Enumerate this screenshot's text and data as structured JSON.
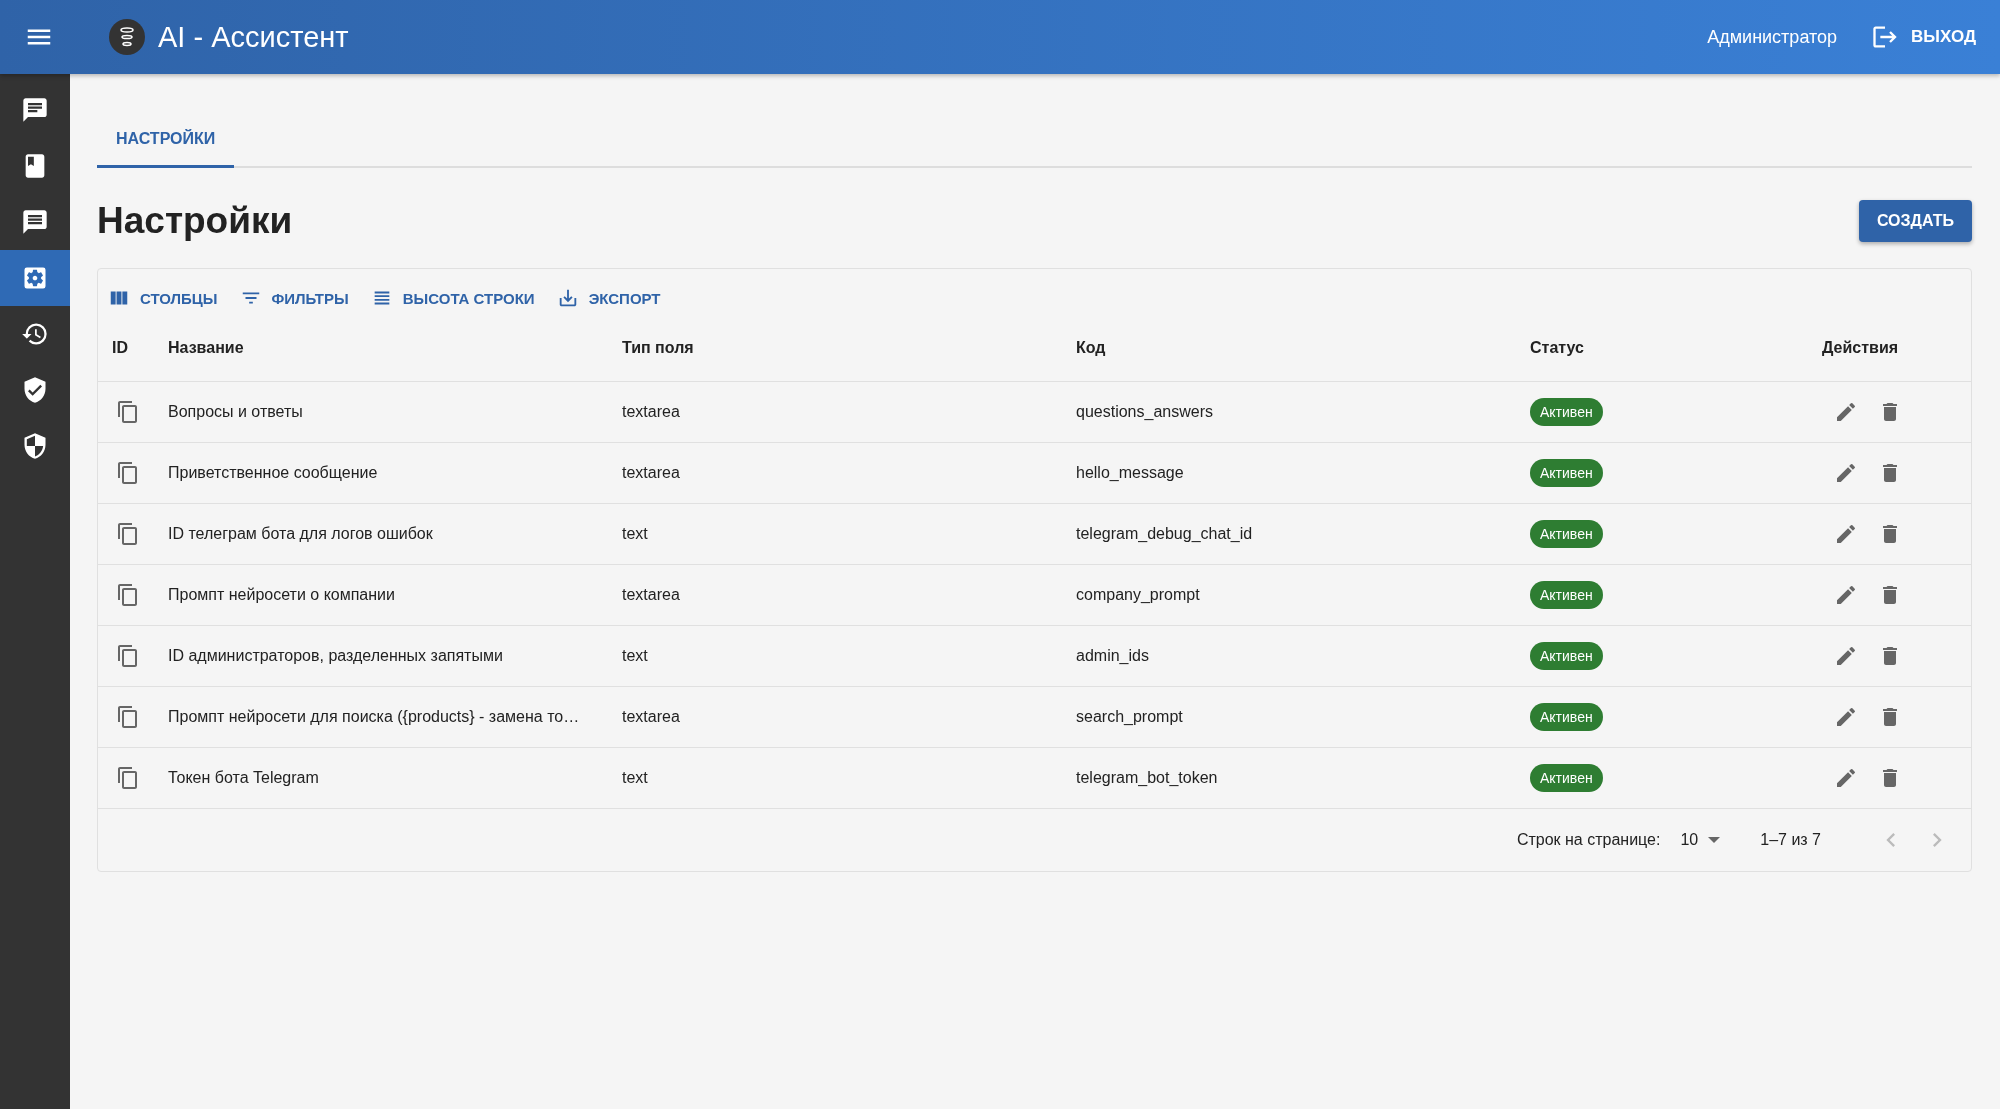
{
  "app_bar": {
    "title": "AI - Ассистент",
    "user": "Администратор",
    "logout": "ВЫХОД"
  },
  "sidebar": {
    "items": [
      {
        "selected": false
      },
      {
        "selected": false
      },
      {
        "selected": false
      },
      {
        "selected": true
      },
      {
        "selected": false
      },
      {
        "selected": false
      },
      {
        "selected": false
      }
    ]
  },
  "tabs": [
    {
      "label": "НАСТРОЙКИ",
      "selected": true
    }
  ],
  "page_title": "Настройки",
  "create_button": "СОЗДАТЬ",
  "toolbar": [
    "СТОЛБЦЫ",
    "ФИЛЬТРЫ",
    "ВЫСОТА СТРОКИ",
    "ЭКСПОРТ"
  ],
  "table": {
    "columns": [
      "ID",
      "Название",
      "Тип поля",
      "Код",
      "Статус",
      "Действия"
    ],
    "rows": [
      {
        "name": "Вопросы и ответы",
        "type": "textarea",
        "code": "questions_answers",
        "status": "Активен"
      },
      {
        "name": "Приветственное сообщение",
        "type": "textarea",
        "code": "hello_message",
        "status": "Активен"
      },
      {
        "name": "ID телеграм бота для логов ошибок",
        "type": "text",
        "code": "telegram_debug_chat_id",
        "status": "Активен"
      },
      {
        "name": "Промпт нейросети о компании",
        "type": "textarea",
        "code": "company_prompt",
        "status": "Активен"
      },
      {
        "name": "ID администраторов, разделенных запятыми",
        "type": "text",
        "code": "admin_ids",
        "status": "Активен"
      },
      {
        "name": "Промпт нейросети для поиска ({products} - замена то…",
        "type": "textarea",
        "code": "search_prompt",
        "status": "Активен"
      },
      {
        "name": "Токен бота Telegram",
        "type": "text",
        "code": "telegram_bot_token",
        "status": "Активен"
      }
    ]
  },
  "pagination": {
    "rows_label": "Строк на странице:",
    "rows_value": "10",
    "range": "1–7 из 7"
  }
}
